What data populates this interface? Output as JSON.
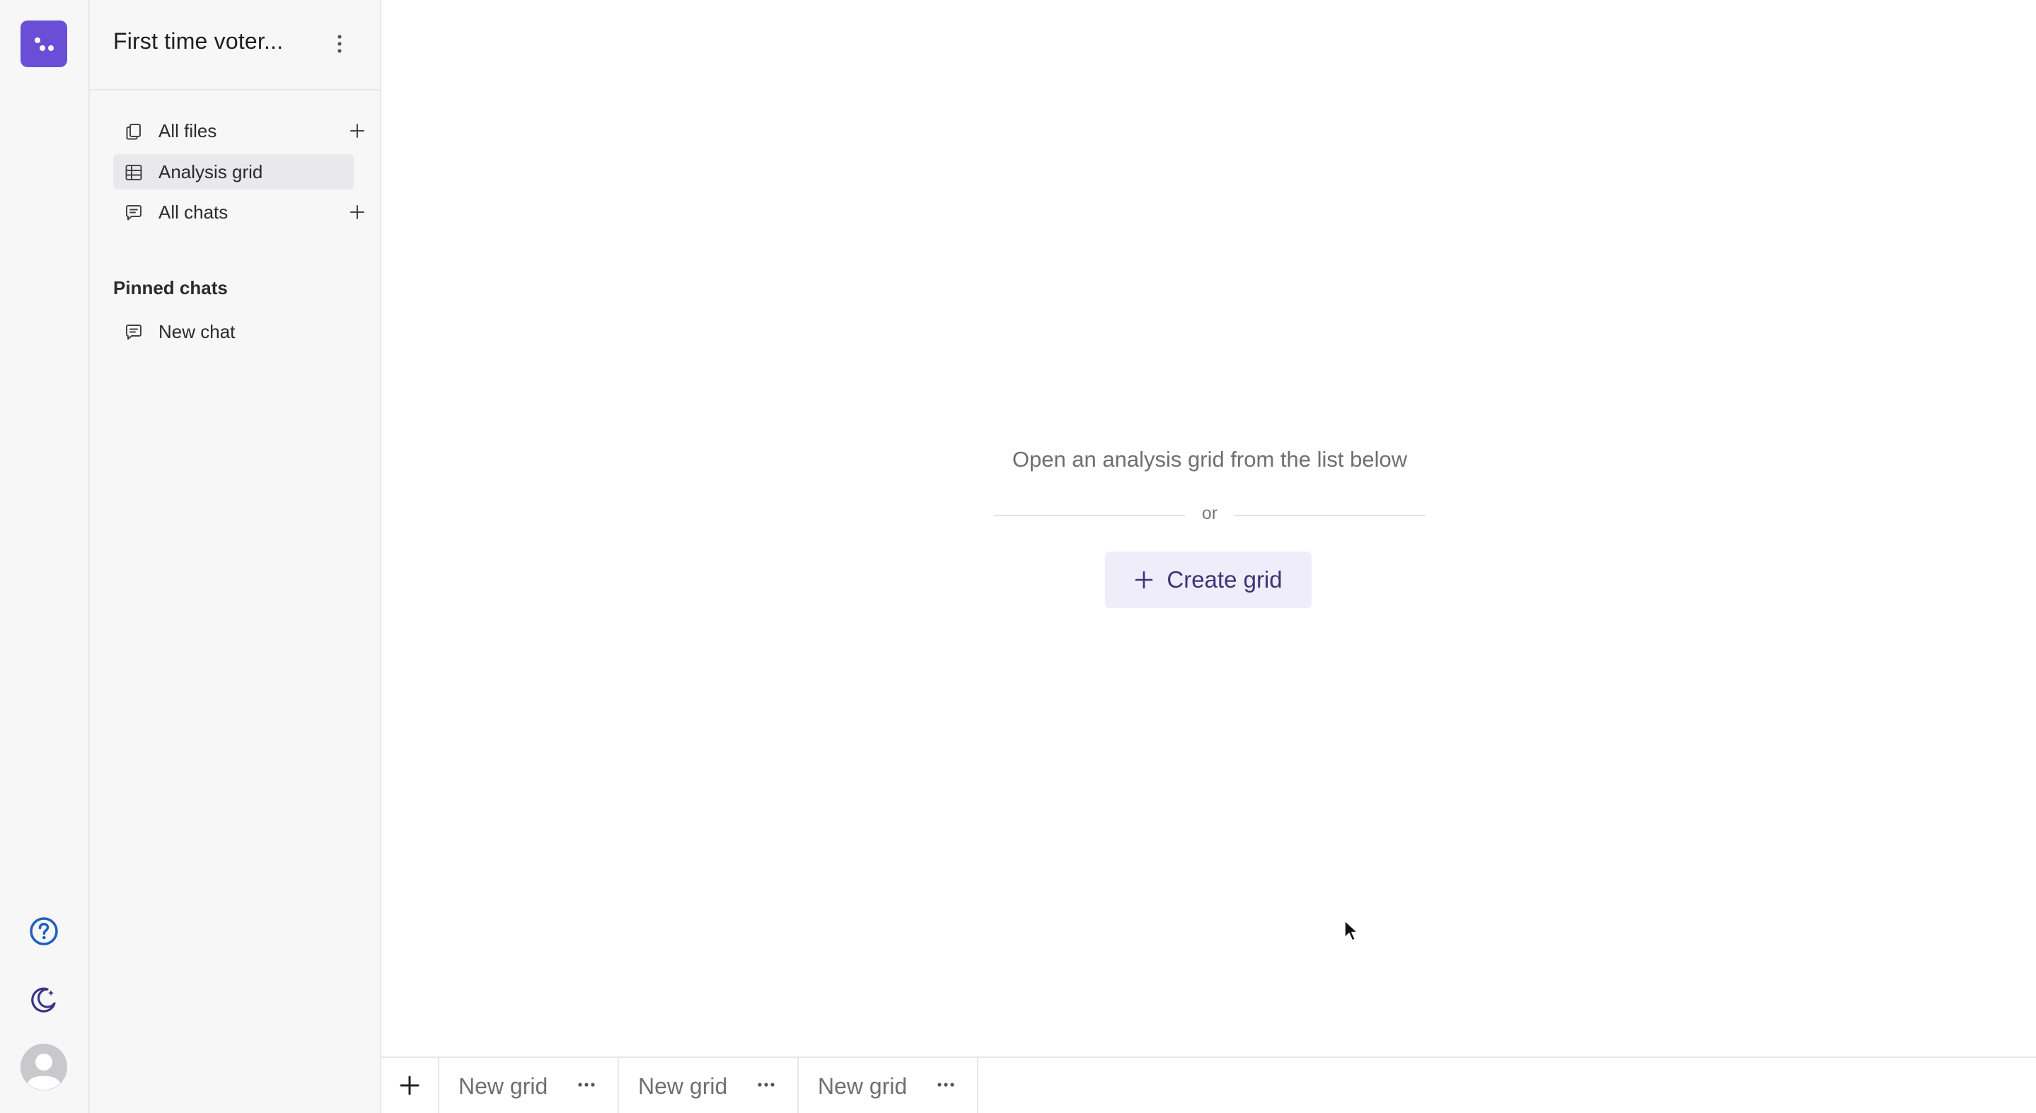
{
  "project": {
    "title": "First time voter..."
  },
  "nav": {
    "items": [
      {
        "label": "All files",
        "icon": "files-icon",
        "has_add": true,
        "active": false
      },
      {
        "label": "Analysis grid",
        "icon": "grid-icon",
        "has_add": false,
        "active": true
      },
      {
        "label": "All chats",
        "icon": "chat-icon",
        "has_add": true,
        "active": false
      }
    ]
  },
  "pinned": {
    "section_title": "Pinned chats",
    "items": [
      {
        "label": "New chat",
        "icon": "chat-icon"
      }
    ]
  },
  "main": {
    "empty_message": "Open an analysis grid from the list below",
    "or_text": "or",
    "create_label": "Create grid"
  },
  "tabs": [
    {
      "label": "New grid"
    },
    {
      "label": "New grid"
    },
    {
      "label": "New grid"
    }
  ],
  "rail": {
    "icons": [
      "app-logo-icon",
      "help-icon",
      "dark-mode-icon",
      "avatar"
    ]
  },
  "colors": {
    "brand": "#6a4fd6",
    "help_accent": "#1f5fbf",
    "create_button_bg": "#efedfa",
    "create_button_text": "#3d3376"
  }
}
